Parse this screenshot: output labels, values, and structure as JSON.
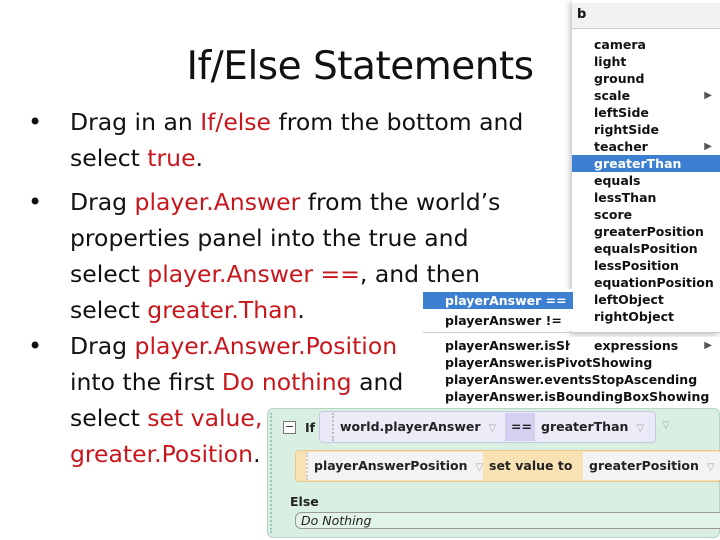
{
  "slide": {
    "title": "If/Else Statements",
    "bullets": [
      {
        "lines": [
          [
            {
              "t": "Drag in an "
            },
            {
              "t": "If/else",
              "red": true
            },
            {
              "t": " from the bottom and"
            }
          ],
          [
            {
              "t": "select "
            },
            {
              "t": "true",
              "red": true
            },
            {
              "t": "."
            }
          ]
        ]
      },
      {
        "lines": [
          [
            {
              "t": "Drag "
            },
            {
              "t": "player.Answer",
              "red": true
            },
            {
              "t": " from the world’s"
            }
          ],
          [
            {
              "t": "properties panel into the true and"
            }
          ],
          [
            {
              "t": "select "
            },
            {
              "t": "player.Answer ==",
              "red": true
            },
            {
              "t": ", and then"
            }
          ],
          [
            {
              "t": "select "
            },
            {
              "t": "greater.Than",
              "red": true
            },
            {
              "t": "."
            }
          ]
        ]
      },
      {
        "lines": [
          [
            {
              "t": "Drag "
            },
            {
              "t": "player.Answer.Position",
              "red": true
            }
          ],
          [
            {
              "t": "into the first "
            },
            {
              "t": "Do nothing",
              "red": true
            },
            {
              "t": " and"
            }
          ],
          [
            {
              "t": "select "
            },
            {
              "t": "set value,",
              "red": true
            }
          ],
          [
            {
              "t": "greater.Position",
              "red": true
            },
            {
              "t": "."
            }
          ]
        ]
      }
    ],
    "bullet_char": "•"
  },
  "menu_right": {
    "header": "b",
    "items": [
      {
        "label": "camera"
      },
      {
        "label": "light"
      },
      {
        "label": "ground"
      },
      {
        "label": "scale",
        "submenu": true
      },
      {
        "label": "leftSide"
      },
      {
        "label": "rightSide"
      },
      {
        "label": "teacher",
        "submenu": true
      },
      {
        "label": "greaterThan",
        "selected": true
      },
      {
        "label": "equals"
      },
      {
        "label": "lessThan"
      },
      {
        "label": "score"
      },
      {
        "label": "greaterPosition"
      },
      {
        "label": "equalsPosition"
      },
      {
        "label": "lessPosition"
      },
      {
        "label": "equationPosition"
      },
      {
        "label": "leftObject"
      },
      {
        "label": "rightObject"
      }
    ],
    "expressions": "expressions",
    "submenu_arrow": "▶"
  },
  "menu_left": {
    "items": [
      {
        "label": "playerAnswer ==",
        "selected": true
      },
      {
        "label": "playerAnswer !="
      }
    ],
    "more": [
      "playerAnswer.isShowing",
      "playerAnswer.isPivotShowing",
      "playerAnswer.eventsStopAscending",
      "playerAnswer.isBoundingBoxShowing"
    ]
  },
  "code": {
    "collapse": "−",
    "if": "If",
    "cond_left": "world.playerAnswer",
    "op": "==",
    "cond_right": "greaterThan",
    "target": "playerAnswerPosition",
    "action": "set value to",
    "value": "greaterPosition",
    "else": "Else",
    "do_nothing": "Do Nothing",
    "dropdown": "▽"
  }
}
